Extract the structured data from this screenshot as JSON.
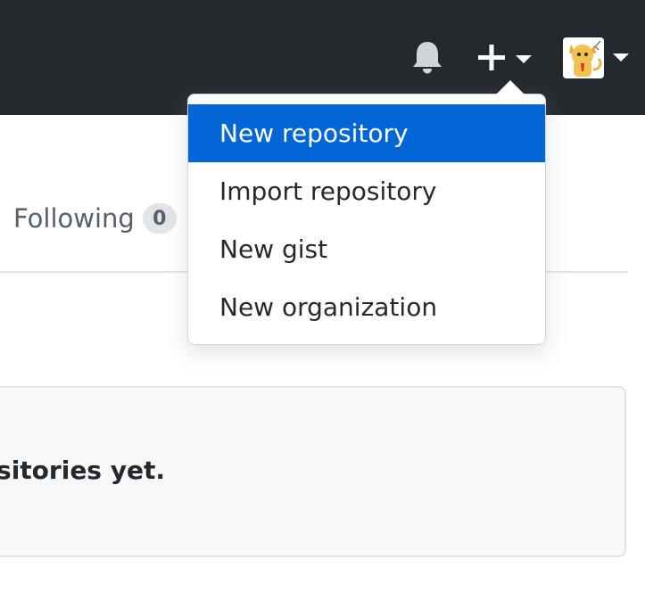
{
  "header": {
    "notifications_icon": "bell-icon",
    "create_icon": "plus-icon",
    "dropdown_indicator_icon": "caret-down-icon",
    "background_color": "#24292e"
  },
  "create_menu": {
    "items": [
      {
        "label": "New repository",
        "active": true
      },
      {
        "label": "Import repository",
        "active": false
      },
      {
        "label": "New gist",
        "active": false
      },
      {
        "label": "New organization",
        "active": false
      }
    ],
    "active_color": "#0366d6"
  },
  "profile_tabs": {
    "following": {
      "label": "Following",
      "count": "0"
    }
  },
  "blankslate": {
    "message": "positories yet."
  }
}
